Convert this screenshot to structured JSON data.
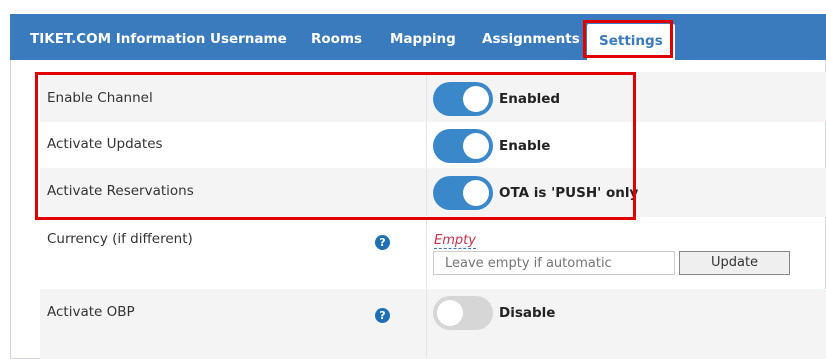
{
  "tabs": [
    {
      "label": "TIKET.COM Information",
      "active": false
    },
    {
      "label": "Username",
      "active": false
    },
    {
      "label": "Rooms",
      "active": false
    },
    {
      "label": "Mapping",
      "active": false
    },
    {
      "label": "Assignments",
      "active": false
    },
    {
      "label": "Settings",
      "active": true
    }
  ],
  "settings": {
    "enable_channel": {
      "label": "Enable Channel",
      "state": "on",
      "value": "Enabled"
    },
    "activate_updates": {
      "label": "Activate Updates",
      "state": "on",
      "value": "Enable"
    },
    "activate_reservations": {
      "label": "Activate Reservations",
      "state": "on",
      "value": "OTA is 'PUSH' only"
    },
    "currency": {
      "label": "Currency (if different)",
      "help": "?",
      "current": "Empty",
      "placeholder": "Leave empty if automatic",
      "button": "Update"
    },
    "activate_obp": {
      "label": "Activate OBP",
      "help": "?",
      "state": "off",
      "value": "Disable"
    }
  },
  "colors": {
    "accent": "#3a7bbd",
    "toggle_on": "#3a87c9",
    "highlight": "#e00000",
    "empty_text": "#c6334a"
  }
}
